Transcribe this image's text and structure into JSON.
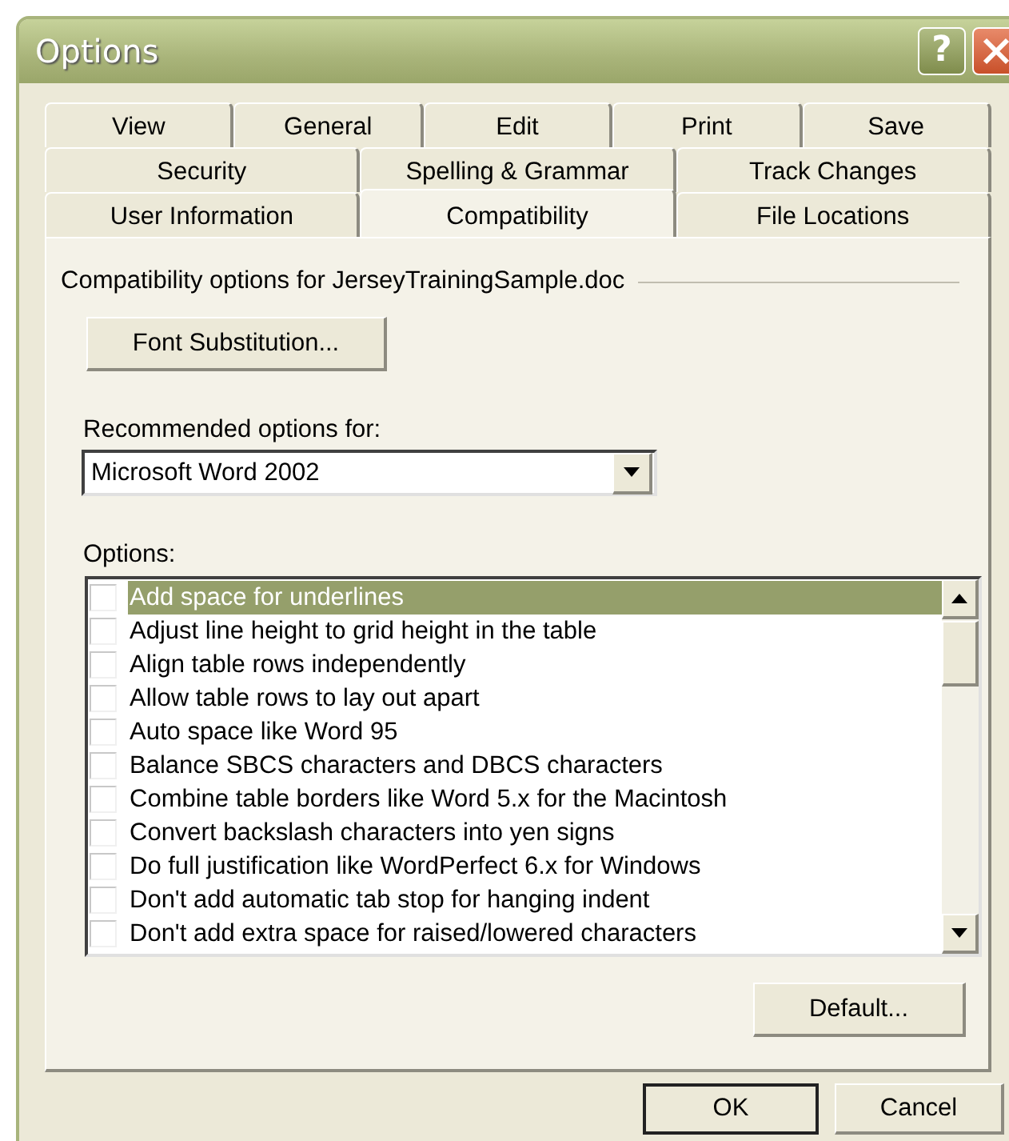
{
  "window": {
    "title": "Options",
    "help_button": "?"
  },
  "tab_rows": [
    [
      {
        "label": "View",
        "selected": false
      },
      {
        "label": "General",
        "selected": false
      },
      {
        "label": "Edit",
        "selected": false
      },
      {
        "label": "Print",
        "selected": false
      },
      {
        "label": "Save",
        "selected": false
      }
    ],
    [
      {
        "label": "Security",
        "selected": false
      },
      {
        "label": "Spelling & Grammar",
        "selected": false
      },
      {
        "label": "Track Changes",
        "selected": false
      }
    ],
    [
      {
        "label": "User Information",
        "selected": false
      },
      {
        "label": "Compatibility",
        "selected": true
      },
      {
        "label": "File Locations",
        "selected": false
      }
    ]
  ],
  "group_caption": "Compatibility options for JerseyTrainingSample.doc",
  "font_substitution_button": "Font Substitution...",
  "recommended": {
    "label": "Recommended options for:",
    "value": "Microsoft Word 2002"
  },
  "options_label": "Options:",
  "options": [
    {
      "label": "Add space for underlines",
      "checked": false,
      "selected": true
    },
    {
      "label": "Adjust line height to grid height in the table",
      "checked": false,
      "selected": false
    },
    {
      "label": "Align table rows independently",
      "checked": false,
      "selected": false
    },
    {
      "label": "Allow table rows to lay out apart",
      "checked": false,
      "selected": false
    },
    {
      "label": "Auto space like Word 95",
      "checked": false,
      "selected": false
    },
    {
      "label": "Balance SBCS characters and DBCS characters",
      "checked": false,
      "selected": false
    },
    {
      "label": "Combine table borders like Word 5.x for the Macintosh",
      "checked": false,
      "selected": false
    },
    {
      "label": "Convert backslash characters into yen signs",
      "checked": false,
      "selected": false
    },
    {
      "label": "Do full justification like WordPerfect 6.x for Windows",
      "checked": false,
      "selected": false
    },
    {
      "label": "Don't add automatic tab stop for hanging indent",
      "checked": false,
      "selected": false
    },
    {
      "label": "Don't add extra space for raised/lowered characters",
      "checked": false,
      "selected": false
    }
  ],
  "default_button": "Default...",
  "buttons": [
    "OK",
    "Cancel"
  ]
}
